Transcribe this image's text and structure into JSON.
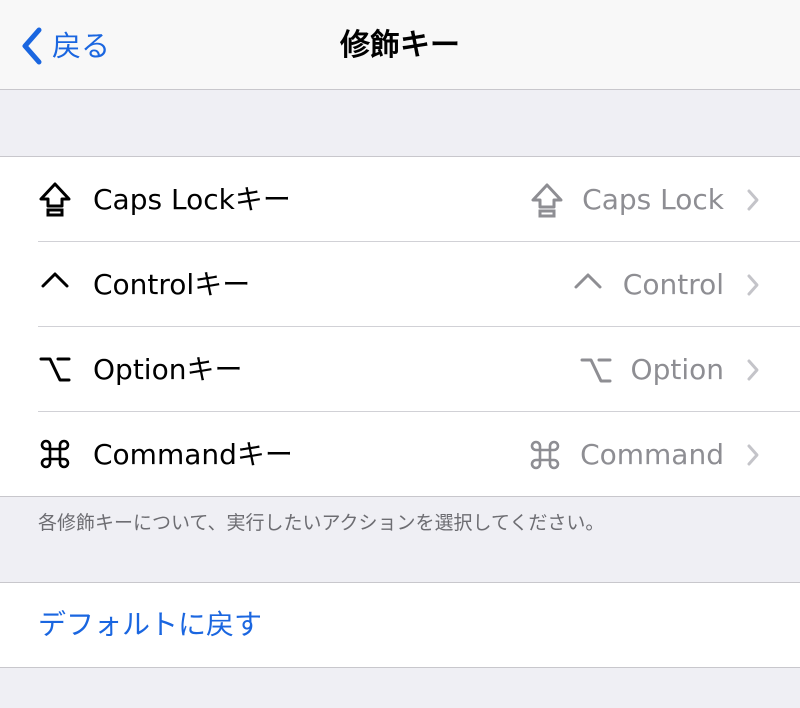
{
  "nav": {
    "back_label": "戻る",
    "title": "修飾キー"
  },
  "modifier_keys": [
    {
      "icon": "caps-lock-icon",
      "label": "Caps Lockキー",
      "value": "Caps Lock"
    },
    {
      "icon": "control-icon",
      "label": "Controlキー",
      "value": "Control"
    },
    {
      "icon": "option-icon",
      "label": "Optionキー",
      "value": "Option"
    },
    {
      "icon": "command-icon",
      "label": "Commandキー",
      "value": "Command"
    }
  ],
  "footnote": "各修飾キーについて、実行したいアクションを選択してください。",
  "reset_label": "デフォルトに戻す",
  "colors": {
    "accent": "#1a66e0",
    "secondary_text": "#8e8e93",
    "background": "#efeff4"
  }
}
